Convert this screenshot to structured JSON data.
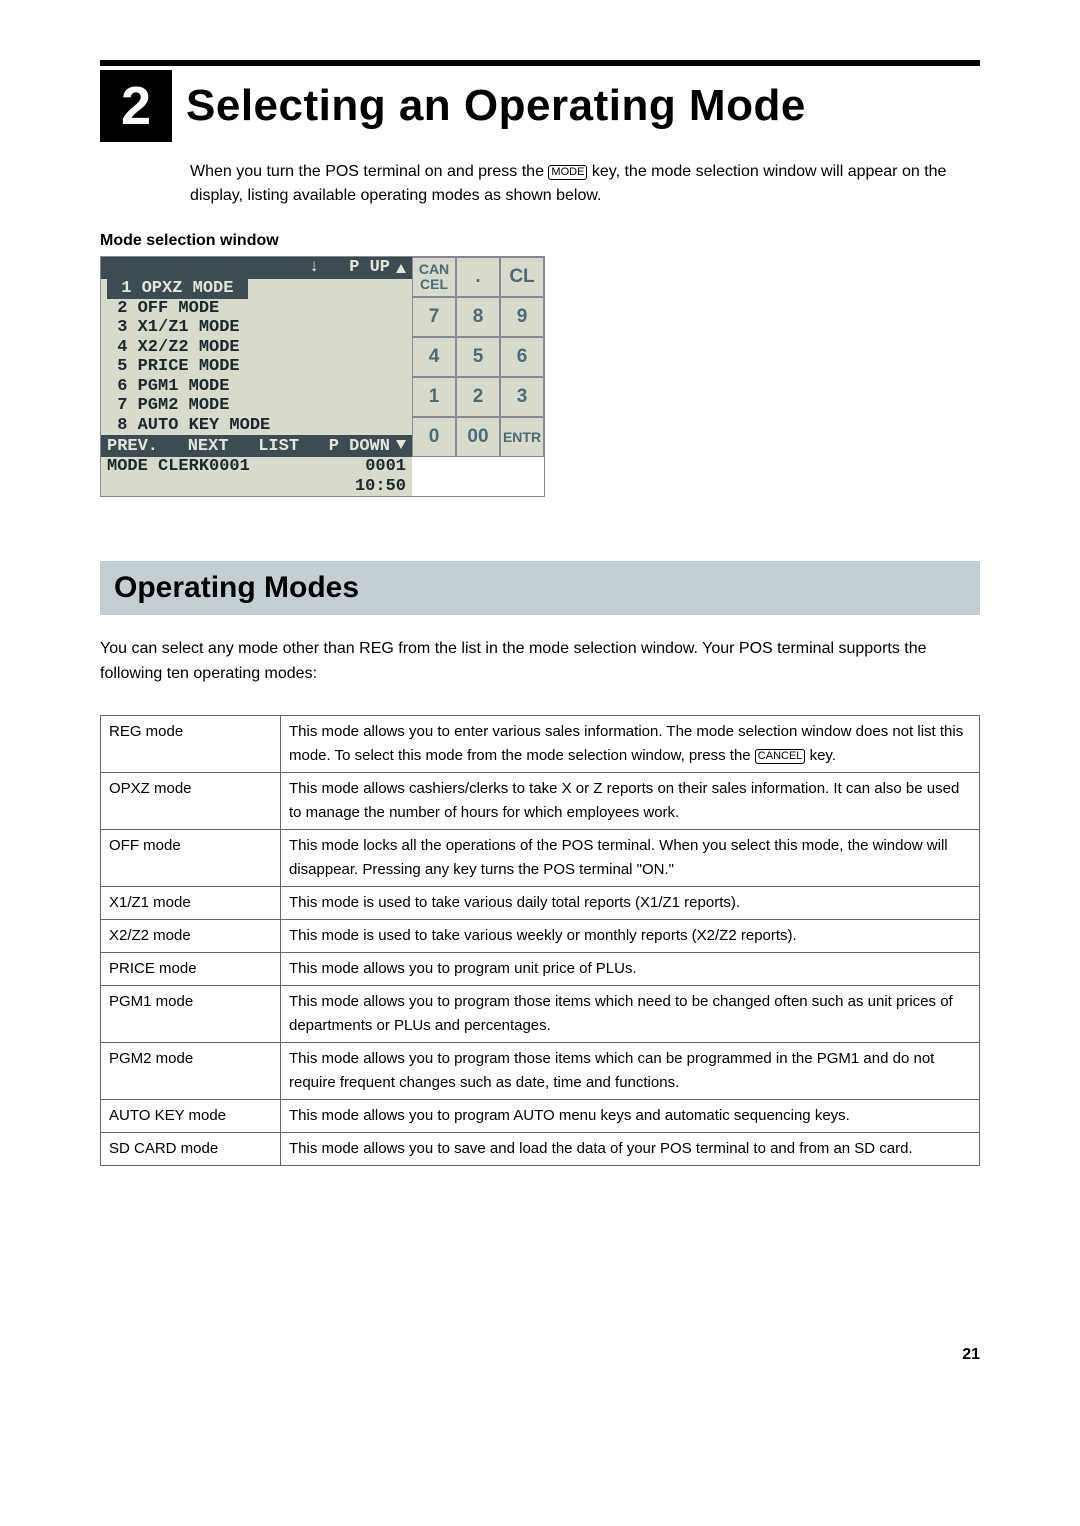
{
  "chapter": {
    "number": "2",
    "title": "Selecting an Operating Mode"
  },
  "intro": {
    "line1_a": "When you turn the POS terminal on and press the ",
    "key1": "MODE",
    "line1_b": " key, the mode selection window will appear on the display, listing available operating modes as shown below."
  },
  "subhead": "Mode selection window",
  "lcd": {
    "hdr_pup": "P UP",
    "sel": " 1 OPXZ MODE ",
    "items": [
      " 2 OFF MODE",
      " 3 X1/Z1 MODE",
      " 4 X2/Z2 MODE",
      " 5 PRICE MODE",
      " 6 PGM1 MODE",
      " 7 PGM2 MODE",
      " 8 AUTO KEY MODE"
    ],
    "ftr_prev": "PREV.",
    "ftr_next": "NEXT",
    "ftr_list": "LIST",
    "ftr_pdown": "P DOWN",
    "status_left": "MODE   CLERK0001",
    "status_right": "0001",
    "time": "10:50"
  },
  "keypad": {
    "r0": [
      "CAN\nCEL",
      ".",
      "CL"
    ],
    "r1": [
      "7",
      "8",
      "9"
    ],
    "r2": [
      "4",
      "5",
      "6"
    ],
    "r3": [
      "1",
      "2",
      "3"
    ],
    "r4": [
      "0",
      "00",
      "ENTR"
    ]
  },
  "section_title": "Operating Modes",
  "section_intro": "You can select any mode other than REG from the list in the mode selection window. Your POS terminal supports the following ten operating modes:",
  "modes": [
    {
      "name": "REG mode",
      "desc_a": "This mode allows you to enter various sales information. The mode selection window does not list this mode. To select this mode from the mode selection window, press the ",
      "key": "CANCEL",
      "desc_b": " key."
    },
    {
      "name": "OPXZ mode",
      "desc": "This mode allows cashiers/clerks to take X or Z reports on their sales information. It can also be used to manage the number of hours for which employees work."
    },
    {
      "name": "OFF mode",
      "desc": "This mode locks all the operations of the POS terminal. When you select this mode, the window will disappear. Pressing any key turns the POS terminal \"ON.\""
    },
    {
      "name": "X1/Z1 mode",
      "desc": "This mode is used to take various daily total reports (X1/Z1 reports)."
    },
    {
      "name": "X2/Z2 mode",
      "desc": "This mode is used to take various weekly or monthly reports (X2/Z2 reports)."
    },
    {
      "name": "PRICE mode",
      "desc": "This mode allows you to program unit price of PLUs."
    },
    {
      "name": "PGM1 mode",
      "desc": "This mode allows you to program those items which need to be changed often such as unit prices of departments or PLUs and percentages."
    },
    {
      "name": "PGM2 mode",
      "desc": "This mode allows you to program those items which can be programmed in the PGM1 and do not require frequent changes such as date, time and functions."
    },
    {
      "name": "AUTO KEY mode",
      "desc": "This mode allows you to program AUTO menu keys and automatic sequencing keys."
    },
    {
      "name": "SD CARD mode",
      "desc": "This mode allows you to save and load the data of your POS terminal to and from an SD card."
    }
  ],
  "page": "21"
}
